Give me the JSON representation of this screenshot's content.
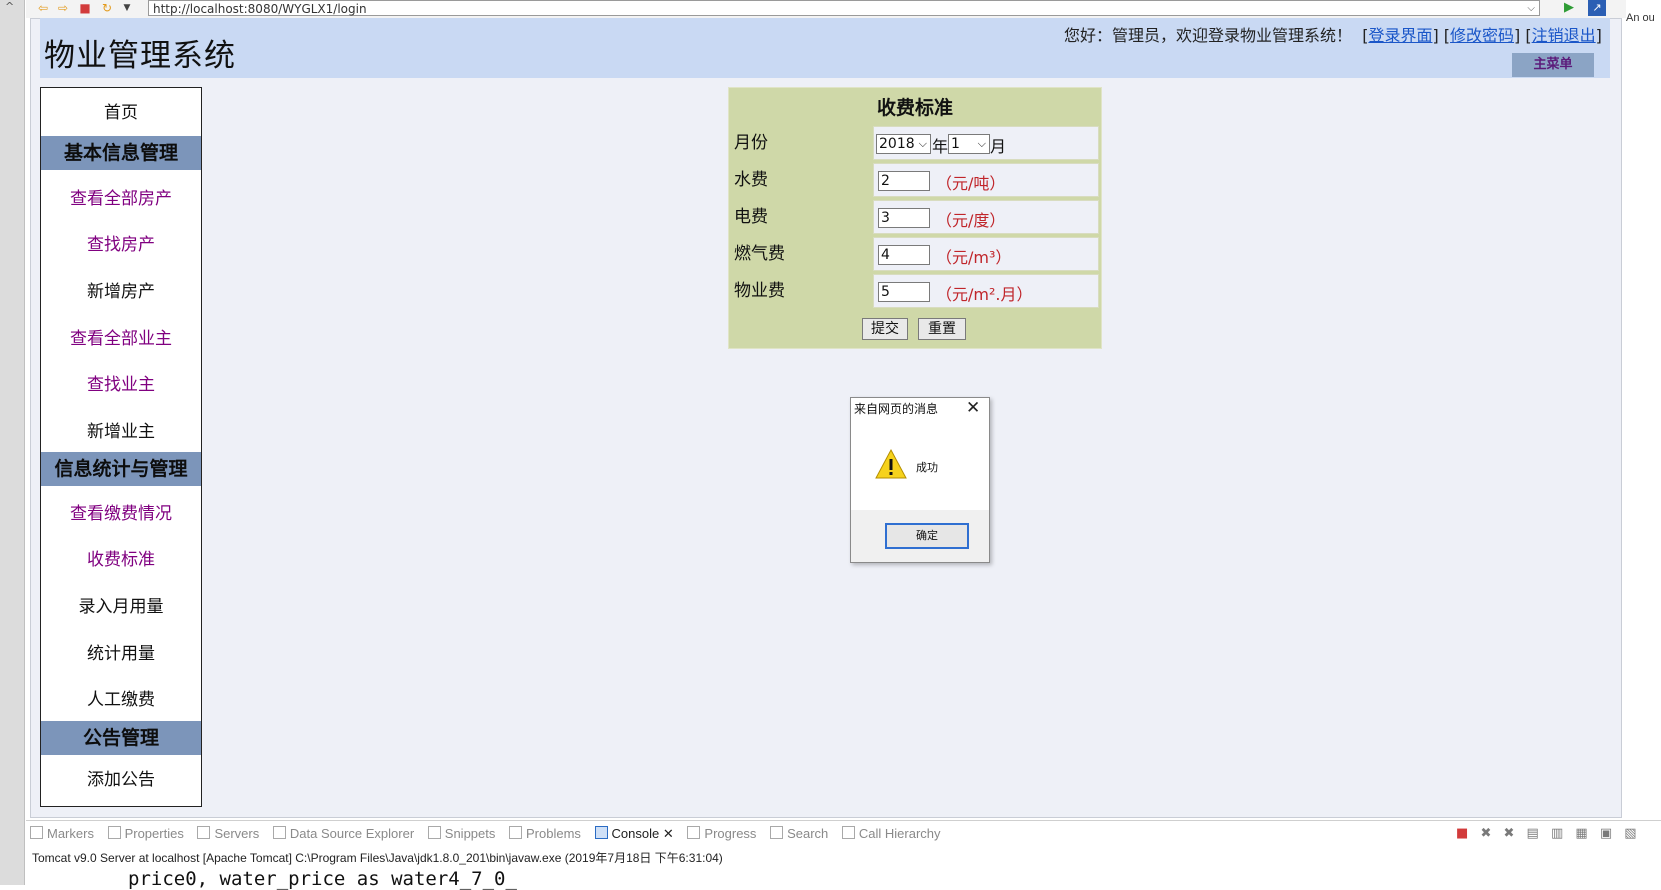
{
  "browser": {
    "url": "http://localhost:8080/WYGLX1/login",
    "side_note": "An ou"
  },
  "header": {
    "site_title": "物业管理系统",
    "welcome": "您好：管理员，欢迎登录物业管理系统！",
    "links": [
      "登录界面",
      "修改密码",
      "注销退出"
    ],
    "main_menu": "主菜单"
  },
  "sidebar": {
    "home": "首页",
    "sections": [
      {
        "title": "基本信息管理",
        "items": [
          "查看全部房产",
          "查找房产",
          "新增房产",
          "查看全部业主",
          "查找业主",
          "新增业主"
        ]
      },
      {
        "title": "信息统计与管理",
        "items": [
          "查看缴费情况",
          "收费标准",
          "录入月用量",
          "统计用量",
          "人工缴费"
        ]
      },
      {
        "title": "公告管理",
        "items": [
          "添加公告"
        ]
      }
    ]
  },
  "fee_form": {
    "title": "收费标准",
    "month_label": "月份",
    "year_value": "2018",
    "year_suffix": "年",
    "month_value": "1",
    "month_suffix": "月",
    "rows": [
      {
        "label": "水费",
        "value": "2",
        "unit": "（元/吨）"
      },
      {
        "label": "电费",
        "value": "3",
        "unit": "（元/度）"
      },
      {
        "label": "燃气费",
        "value": "4",
        "unit": "（元/m³）"
      },
      {
        "label": "物业费",
        "value": "5",
        "unit": "（元/m².月）"
      }
    ],
    "submit": "提交",
    "reset": "重置"
  },
  "dialog": {
    "title": "来自网页的消息",
    "message": "成功",
    "ok": "确定"
  },
  "ide": {
    "tabs": [
      "Markers",
      "Properties",
      "Servers",
      "Data Source Explorer",
      "Snippets",
      "Problems",
      "Console",
      "Progress",
      "Search",
      "Call Hierarchy"
    ],
    "active_tab": "Console",
    "server_line": "Tomcat v9.0 Server at localhost [Apache Tomcat] C:\\Program Files\\Java\\jdk1.8.0_201\\bin\\javaw.exe (2019年7月18日 下午6:31:04)",
    "console_text": "price0, water_price as water4_7_0_"
  },
  "colors": {
    "header_bg": "#c9d9f3",
    "section_bg": "#7c95ba",
    "form_bg": "#cfd8a8",
    "unit_red": "#c0252a",
    "link_blue": "#1a56c8",
    "visited_purple": "#800080"
  }
}
